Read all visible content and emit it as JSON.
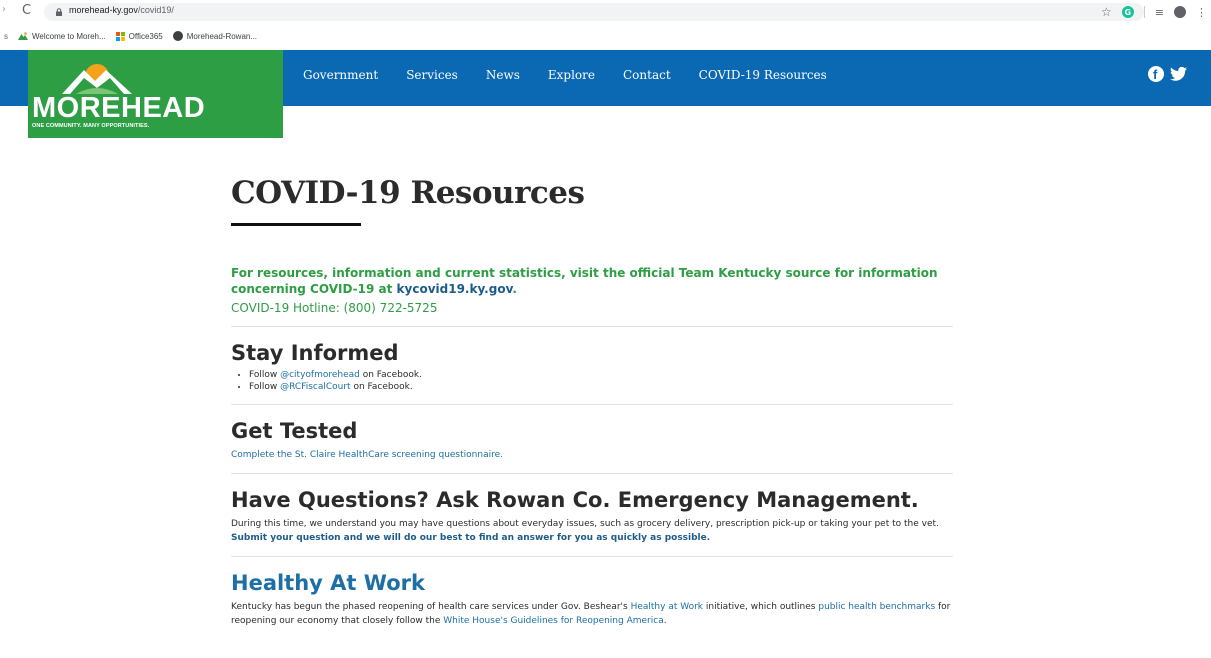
{
  "browser": {
    "url_host": "morehead-ky.gov",
    "url_path": "/covid19/",
    "bookmarks": [
      {
        "label": "Welcome to Moreh...",
        "icon": "mountain-icon"
      },
      {
        "label": "Office365",
        "icon": "microsoft-icon"
      },
      {
        "label": "Morehead-Rowan...",
        "icon": "globe-icon"
      }
    ],
    "apps_label": "s"
  },
  "site": {
    "logo_word": "MOREHEAD",
    "logo_tagline": "ONE COMMUNITY. MANY OPPORTUNITIES.",
    "nav": [
      "Government",
      "Services",
      "News",
      "Explore",
      "Contact",
      "COVID-19 Resources"
    ],
    "colors": {
      "nav_blue": "#0b68b3",
      "logo_green": "#2e9e45",
      "link_blue": "#1d6fa5"
    }
  },
  "page": {
    "title": "COVID-19 Resources",
    "intro_text": "For resources, information and current statistics, visit the official Team Kentucky source for information concerning COVID-19 at ",
    "intro_link": "kycovid19.ky.gov",
    "intro_end": ".",
    "hotline": "COVID-19 Hotline: (800) 722-5725",
    "stay_informed": {
      "heading": "Stay Informed",
      "items": [
        {
          "pre": "Follow ",
          "link": "@cityofmorehead",
          "post": " on Facebook."
        },
        {
          "pre": "Follow ",
          "link": "@RCFiscalCourt",
          "post": " on Facebook."
        }
      ]
    },
    "get_tested": {
      "heading": "Get Tested",
      "link": "Complete the St. Claire HealthCare screening questionnaire."
    },
    "questions": {
      "heading": "Have Questions? Ask Rowan Co. Emergency Management.",
      "text": "During this time, we understand you may have questions about everyday issues, such as grocery delivery, prescription pick-up or taking your pet to the vet. ",
      "link": "Submit your question and we will do our best to find an answer for you as quickly as possible."
    },
    "healthy_at_work": {
      "heading": "Healthy At Work",
      "t1": "Kentucky has begun the phased reopening of health care services under Gov. Beshear's ",
      "l1": "Healthy at Work",
      "t2": " initiative, which outlines ",
      "l2": "public health benchmarks",
      "t3": " for reopening our economy that closely follow the ",
      "l3": "White House's Guidelines for Reopening America",
      "t4": "."
    }
  }
}
